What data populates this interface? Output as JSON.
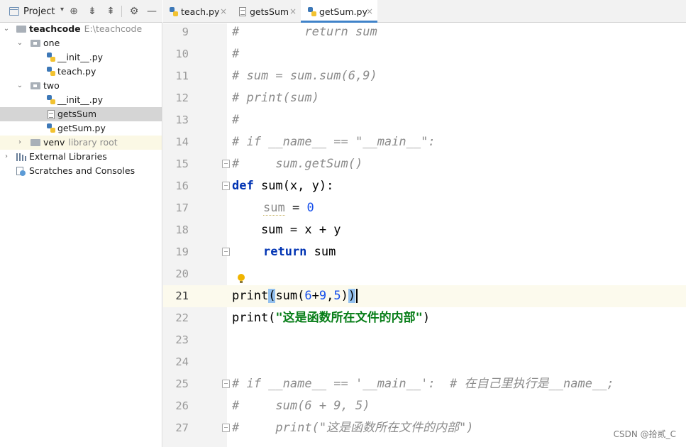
{
  "project_panel": {
    "title": "Project",
    "tree": [
      {
        "label": "teachcode",
        "hint": "E:\\teachcode",
        "bold": true
      },
      {
        "label": "one"
      },
      {
        "label": "__init__.py"
      },
      {
        "label": "teach.py"
      },
      {
        "label": "two"
      },
      {
        "label": "__init__.py"
      },
      {
        "label": "getsSum"
      },
      {
        "label": "getSum.py"
      },
      {
        "label": "venv",
        "hint": "library root"
      },
      {
        "label": "External Libraries"
      },
      {
        "label": "Scratches and Consoles"
      }
    ]
  },
  "tabs": [
    {
      "label": "teach.py",
      "close": "×"
    },
    {
      "label": "getsSum",
      "close": "×"
    },
    {
      "label": "getSum.py",
      "close": "×"
    }
  ],
  "editor": {
    "line_numbers": [
      "9",
      "10",
      "11",
      "12",
      "13",
      "14",
      "15",
      "16",
      "17",
      "18",
      "19",
      "20",
      "21",
      "22",
      "23",
      "24",
      "25",
      "26",
      "27"
    ],
    "current_line": "21",
    "lines": {
      "l9": "#         return sum",
      "l10": "#",
      "l11": "# sum = sum.sum(6,9)",
      "l12": "# print(sum)",
      "l13": "#",
      "l14": "# if __name__ == \"__main__\":",
      "l15": "#     sum.getSum()",
      "l16_kw": "def",
      "l16_rest": " sum(x, y):",
      "l17_var": "sum",
      "l17_op": " = ",
      "l17_num": "0",
      "l18": "    sum = x + y",
      "l19_kw": "return",
      "l19_rest": " sum",
      "l21_print": "print",
      "l21_open": "(",
      "l21_sum": "sum(",
      "l21_n1": "6",
      "l21_plus": "+",
      "l21_n2": "9",
      "l21_comma": ",",
      "l21_n3": "5",
      "l21_close1": ")",
      "l21_close2": ")",
      "l22_print": "print(",
      "l22_str": "\"这是函数所在文件的内部\"",
      "l22_close": ")",
      "l25": "# if __name__ == '__main__':  # 在自己里执行是__name__;",
      "l26": "#     sum(6 + 9, 5)",
      "l27": "#     print(\"这是函数所在文件的内部\")"
    }
  },
  "watermark": "CSDN @拾贰_C",
  "colors": {
    "keyword": "#0033b3",
    "string": "#067d17",
    "number": "#1750eb",
    "comment": "#8c8c8c",
    "active_tab_underline": "#4083c9",
    "current_line_bg": "#fcfaed"
  }
}
